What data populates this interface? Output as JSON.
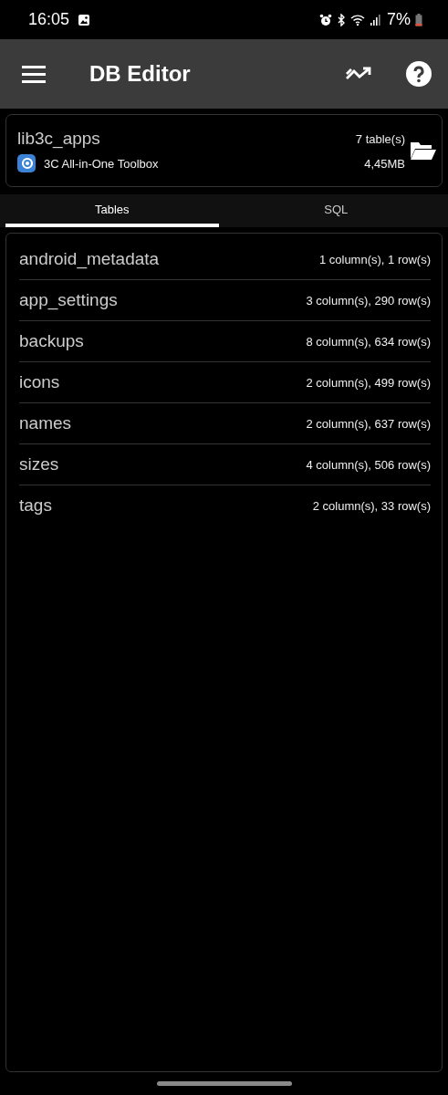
{
  "status_bar": {
    "time": "16:05",
    "battery": "7%"
  },
  "app_bar": {
    "title": "DB Editor"
  },
  "database": {
    "name": "lib3c_apps",
    "tables_count": "7 table(s)",
    "app_name": "3C All-in-One Toolbox",
    "size": "4,45MB"
  },
  "tabs": [
    {
      "label": "Tables",
      "selected": true
    },
    {
      "label": "SQL",
      "selected": false
    }
  ],
  "tables": [
    {
      "name": "android_metadata",
      "info": "1 column(s), 1 row(s)"
    },
    {
      "name": "app_settings",
      "info": "3 column(s), 290 row(s)"
    },
    {
      "name": "backups",
      "info": "8 column(s), 634 row(s)"
    },
    {
      "name": "icons",
      "info": "2 column(s), 499 row(s)"
    },
    {
      "name": "names",
      "info": "2 column(s), 637 row(s)"
    },
    {
      "name": "sizes",
      "info": "4 column(s), 506 row(s)"
    },
    {
      "name": "tags",
      "info": "2 column(s), 33 row(s)"
    }
  ]
}
